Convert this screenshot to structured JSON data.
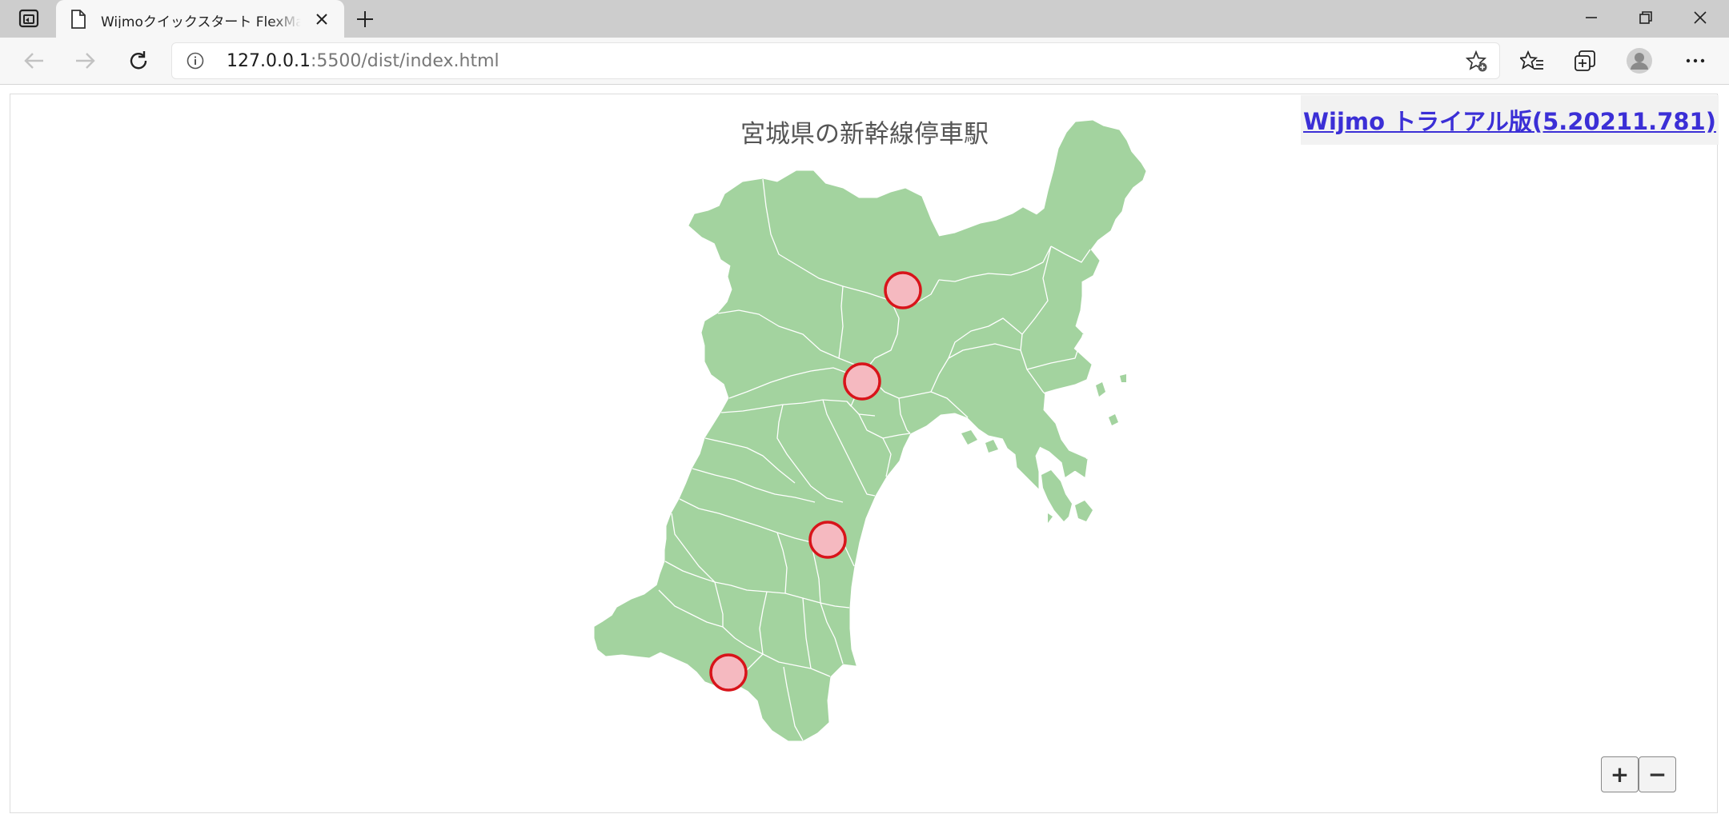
{
  "browser": {
    "tab": {
      "title": "Wijmoクイックスタート FlexMapサンプル"
    },
    "address": {
      "host": "127.0.0.1",
      "path": ":5500/dist/index.html"
    }
  },
  "page": {
    "map_title": "宮城県の新幹線停車駅",
    "license_link": "Wijmo トライアル版(5.20211.781)",
    "zoom_in": "+",
    "zoom_out": "−",
    "map_colors": {
      "land": "#a3d39f",
      "border": "#ffffff",
      "marker_fill": "#f5b9c0",
      "marker_stroke": "#d8141a"
    },
    "station_markers": 4
  }
}
